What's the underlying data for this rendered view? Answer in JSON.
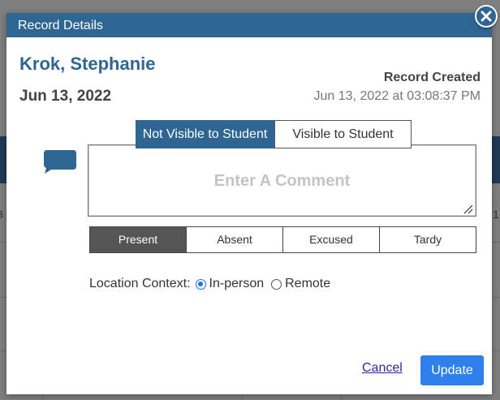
{
  "background": {
    "left_fragment": "3",
    "right_fragment": "1"
  },
  "modal": {
    "title": "Record Details",
    "close_icon": "close-icon"
  },
  "record": {
    "student_name": "Krok, Stephanie",
    "date": "Jun 13, 2022",
    "created_label": "Record Created",
    "created_value": "Jun 13, 2022 at 03:08:37 PM"
  },
  "comment": {
    "icon": "speech-bubble-icon",
    "visibility_options": [
      "Not Visible to Student",
      "Visible to Student"
    ],
    "visibility_selected": "Not Visible to Student",
    "placeholder": "Enter A Comment",
    "value": ""
  },
  "attendance": {
    "options": [
      "Present",
      "Absent",
      "Excused",
      "Tardy"
    ],
    "selected": "Present"
  },
  "location": {
    "label": "Location Context:",
    "options": [
      "In-person",
      "Remote"
    ],
    "selected": "In-person"
  },
  "actions": {
    "cancel_label": "Cancel",
    "update_label": "Update"
  },
  "colors": {
    "header": "#2f6592",
    "name_text": "#2f6592",
    "active_toggle": "#2f6592",
    "active_attendance": "#555555",
    "update_button": "#2f80ed",
    "link": "#2a2aa8",
    "overlay": "#7f7f7f"
  }
}
